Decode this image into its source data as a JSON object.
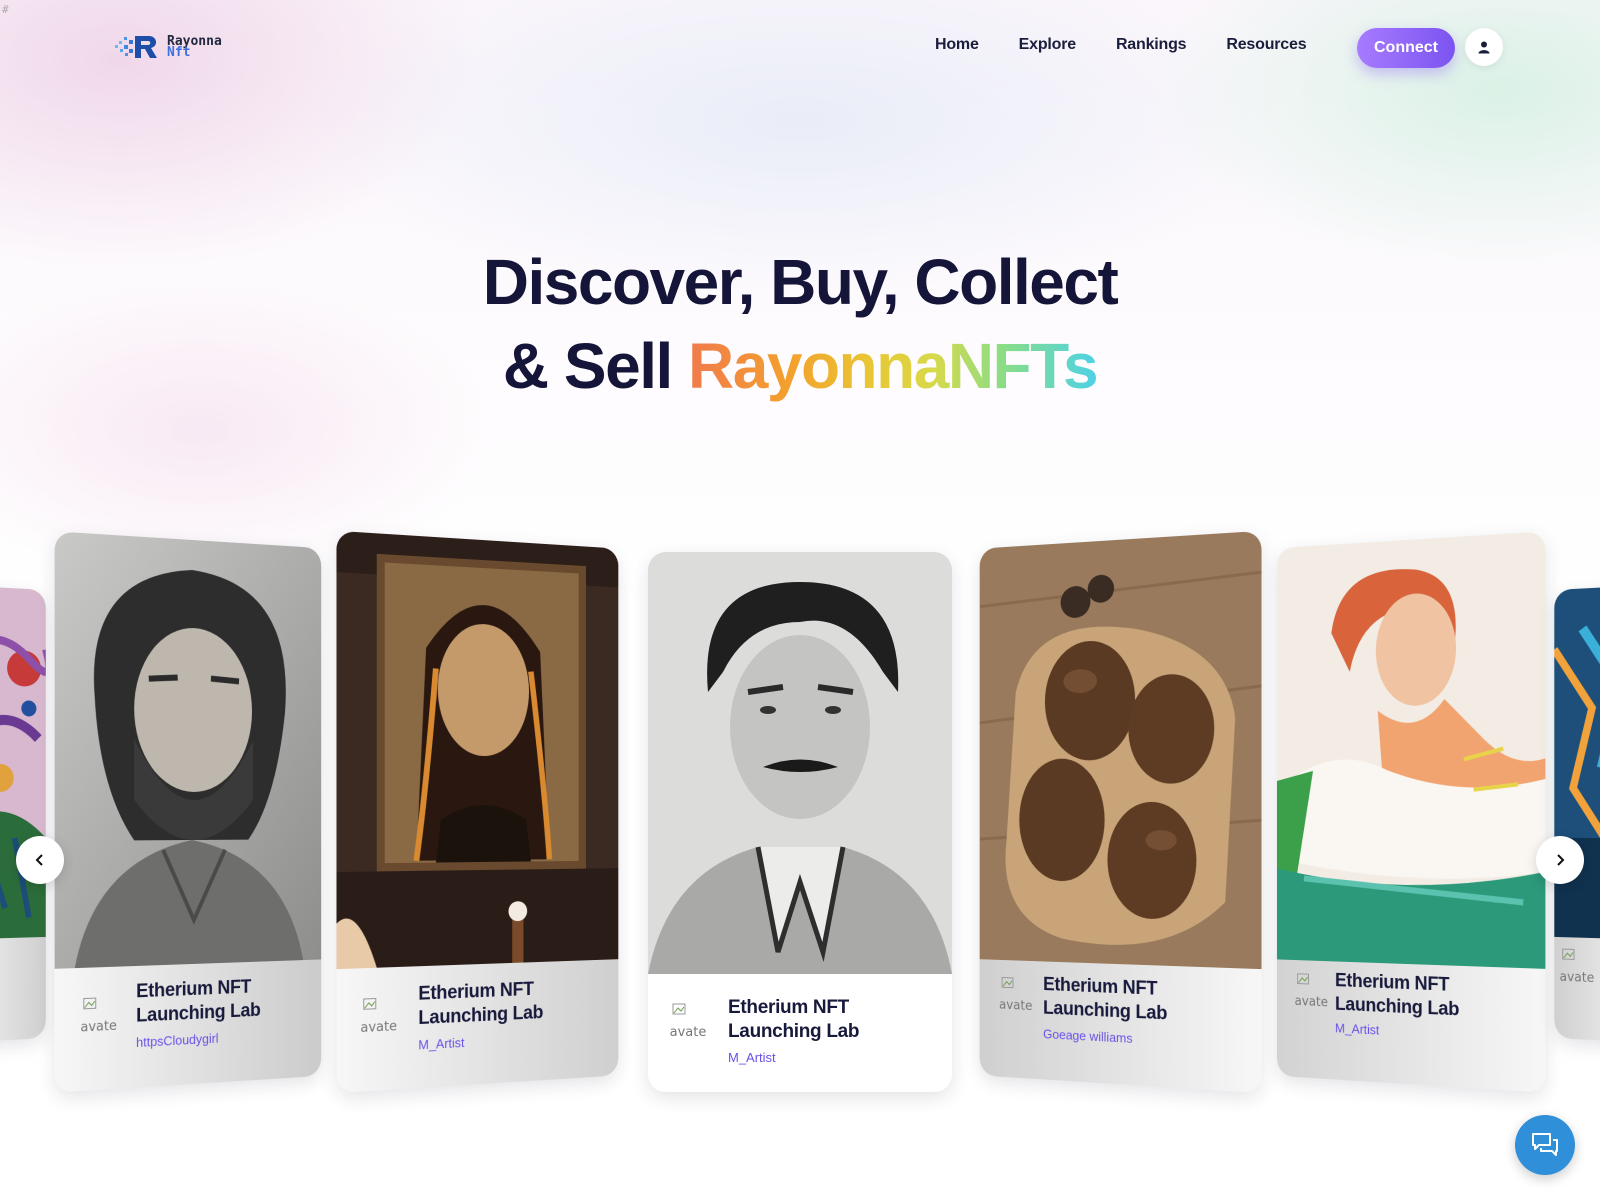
{
  "page_marker": "#",
  "logo": {
    "line1": "Rayonna",
    "line2": "Nft"
  },
  "nav": {
    "items": [
      "Home",
      "Explore",
      "Rankings",
      "Resources"
    ],
    "connect_label": "Connect"
  },
  "hero": {
    "line1": "Discover, Buy, Collect",
    "line2_prefix": "& Sell ",
    "line2_highlight": "RayonnaNFTs"
  },
  "cards": [
    {
      "title_line1": "Etherium NFT",
      "title_line2": "Launching Lab",
      "author": "httpsCloudygirl",
      "avatar_alt": "avate",
      "art": "bearded-man-sketch"
    },
    {
      "title_line1": "Etherium NFT",
      "title_line2": "Launching Lab",
      "author": "M_Artist",
      "avatar_alt": "avate",
      "art": "woman-portrait-painting"
    },
    {
      "title_line1": "Etherium NFT",
      "title_line2": "Launching Lab",
      "author": "M_Artist",
      "avatar_alt": "avate",
      "art": "man-mustache-pencil-portrait"
    },
    {
      "title_line1": "Etherium NFT",
      "title_line2": "Launching Lab",
      "author": "Goeage williams",
      "avatar_alt": "avate",
      "art": "wooden-bowl-tray"
    },
    {
      "title_line1": "Etherium NFT",
      "title_line2": "Launching Lab",
      "author": "M_Artist",
      "avatar_alt": "avate",
      "art": "red-hair-woman-pastel"
    },
    {
      "avatar_alt": "avate",
      "art": "blue-abstract-painting"
    }
  ],
  "colors": {
    "accent": "#7b54f0",
    "text_dark": "#141538",
    "chat": "#2f8fd8"
  }
}
